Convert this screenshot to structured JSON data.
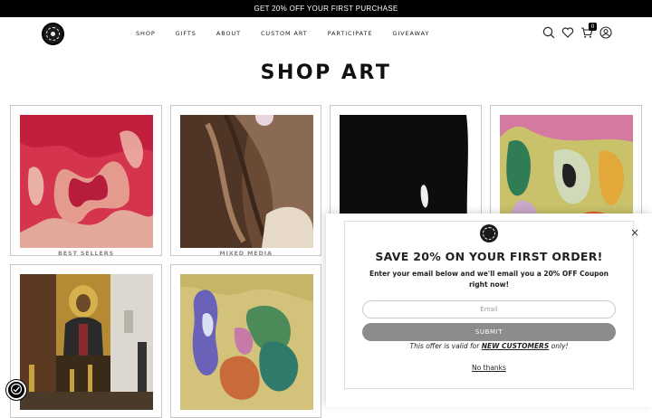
{
  "promo_bar": {
    "text": "GET 20% OFF YOUR FIRST PURCHASE"
  },
  "nav": {
    "items": [
      "SHOP",
      "GIFTS",
      "ABOUT",
      "CUSTOM ART",
      "PARTICIPATE",
      "GIVEAWAY"
    ]
  },
  "header_icons": {
    "search": "search-icon",
    "wishlist": "heart-icon",
    "cart": "cart-icon",
    "cart_count": "0",
    "account": "user-icon"
  },
  "page": {
    "title": "SHOP ART"
  },
  "collections": [
    {
      "caption": "BEST SELLERS"
    },
    {
      "caption": "MIXED MEDIA"
    },
    {
      "caption": ""
    },
    {
      "caption": ""
    },
    {
      "caption": ""
    },
    {
      "caption": ""
    }
  ],
  "popup": {
    "heading": "SAVE 20% ON YOUR FIRST ORDER!",
    "description": "Enter your email below and we'll email you a 20% OFF Coupon right now!",
    "email_placeholder": "Email",
    "submit_label": "SUBMIT",
    "offer_prefix": "This offer is valid for",
    "offer_highlight": "NEW CUSTOMERS",
    "offer_suffix": "only!",
    "decline_label": "No thanks",
    "close_label": "×"
  },
  "colors": {
    "topbar": "#000000",
    "submit": "#8c8c8c"
  }
}
